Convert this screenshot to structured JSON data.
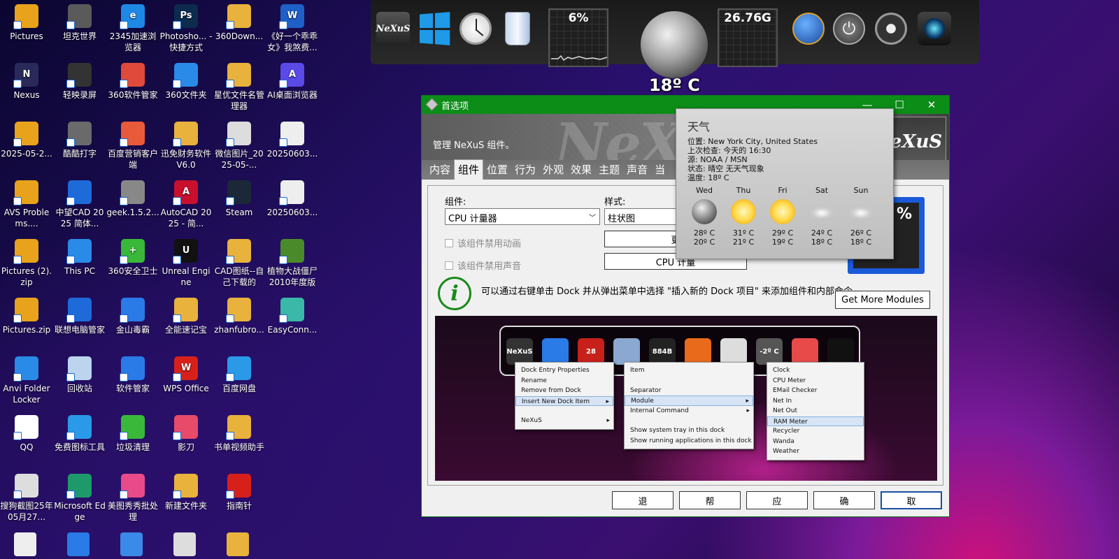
{
  "desktop": {
    "icons": [
      {
        "label": "Pictures",
        "color": "#e8a21c",
        "glyph": ""
      },
      {
        "label": "坦克世界",
        "color": "#5a5a5a",
        "glyph": ""
      },
      {
        "label": "2345加速浏览器",
        "color": "#1e88e5",
        "glyph": "e"
      },
      {
        "label": "Photosho... - 快捷方式",
        "color": "#0d2b4e",
        "glyph": "Ps"
      },
      {
        "label": "360Down...",
        "color": "#e8b23c",
        "glyph": ""
      },
      {
        "label": "《好一个乖乖女》我煞费...",
        "color": "#1e5fc8",
        "glyph": "W"
      },
      {
        "label": "Nexus",
        "color": "#2a2a5a",
        "glyph": "N"
      },
      {
        "label": "轻映录屏",
        "color": "#333333",
        "glyph": ""
      },
      {
        "label": "360软件管家",
        "color": "#e04a3a",
        "glyph": ""
      },
      {
        "label": "360文件夹",
        "color": "#2a8ae8",
        "glyph": ""
      },
      {
        "label": "星优文件名管理器",
        "color": "#e8b23c",
        "glyph": ""
      },
      {
        "label": "AI桌面浏览器",
        "color": "#5a4ae8",
        "glyph": "A"
      },
      {
        "label": "2025-05-2...",
        "color": "#e8a21c",
        "glyph": ""
      },
      {
        "label": "酷酷打字",
        "color": "#6a6a6a",
        "glyph": ""
      },
      {
        "label": "百度营销客户端",
        "color": "#e85a3a",
        "glyph": ""
      },
      {
        "label": "迅免财务软件V6.0",
        "color": "#e8b23c",
        "glyph": ""
      },
      {
        "label": "微信图片_2025-05-...",
        "color": "#dddddd",
        "glyph": ""
      },
      {
        "label": "20250603...",
        "color": "#eeeeee",
        "glyph": ""
      },
      {
        "label": "AVS Problems....",
        "color": "#e8a21c",
        "glyph": ""
      },
      {
        "label": "中望CAD 2025 简体...",
        "color": "#1e6ad8",
        "glyph": ""
      },
      {
        "label": "geek.1.5.2...",
        "color": "#888888",
        "glyph": ""
      },
      {
        "label": "AutoCAD 2025 - 简...",
        "color": "#c8102e",
        "glyph": "A"
      },
      {
        "label": "Steam",
        "color": "#1b2838",
        "glyph": ""
      },
      {
        "label": "20250603...",
        "color": "#eeeeee",
        "glyph": ""
      },
      {
        "label": "Pictures (2).zip",
        "color": "#e8a21c",
        "glyph": ""
      },
      {
        "label": "This PC",
        "color": "#2a8ae8",
        "glyph": ""
      },
      {
        "label": "360安全卫士",
        "color": "#3ab83a",
        "glyph": "+"
      },
      {
        "label": "Unreal Engine",
        "color": "#111111",
        "glyph": "U"
      },
      {
        "label": "CAD图纸--自己下载的",
        "color": "#e8b23c",
        "glyph": ""
      },
      {
        "label": "植物大战僵尸2010年度版",
        "color": "#4a8a2a",
        "glyph": ""
      },
      {
        "label": "Pictures.zip",
        "color": "#e8a21c",
        "glyph": ""
      },
      {
        "label": "联想电脑管家",
        "color": "#1e6ad8",
        "glyph": ""
      },
      {
        "label": "金山毒霸",
        "color": "#2a7ae8",
        "glyph": ""
      },
      {
        "label": "全能速记宝",
        "color": "#e8b23c",
        "glyph": ""
      },
      {
        "label": "zhanfubro...",
        "color": "#e8b23c",
        "glyph": ""
      },
      {
        "label": "EasyConn...",
        "color": "#3ab8a8",
        "glyph": ""
      },
      {
        "label": "Anvi Folder Locker",
        "color": "#2a8ae8",
        "glyph": ""
      },
      {
        "label": "回收站",
        "color": "#bcd4ee",
        "glyph": ""
      },
      {
        "label": "软件管家",
        "color": "#2a7ae8",
        "glyph": ""
      },
      {
        "label": "WPS Office",
        "color": "#d8201a",
        "glyph": "W"
      },
      {
        "label": "百度网盘",
        "color": "#2a9ae8",
        "glyph": ""
      },
      {
        "label": "",
        "color": "",
        "glyph": ""
      },
      {
        "label": "QQ",
        "color": "#ffffff",
        "glyph": ""
      },
      {
        "label": "免费图标工具",
        "color": "#2a9ae8",
        "glyph": ""
      },
      {
        "label": "垃圾清理",
        "color": "#3ab83a",
        "glyph": ""
      },
      {
        "label": "影刀",
        "color": "#e84a6a",
        "glyph": ""
      },
      {
        "label": "书单视频助手",
        "color": "#e8b23c",
        "glyph": ""
      },
      {
        "label": "",
        "color": "",
        "glyph": ""
      },
      {
        "label": "搜狗截图25年05月27...",
        "color": "#dddddd",
        "glyph": ""
      },
      {
        "label": "Microsoft Edge",
        "color": "#1e9a6a",
        "glyph": ""
      },
      {
        "label": "美图秀秀批处理",
        "color": "#e84a8a",
        "glyph": ""
      },
      {
        "label": "新建文件夹",
        "color": "#e8b23c",
        "glyph": ""
      },
      {
        "label": "指南针",
        "color": "#d8201a",
        "glyph": ""
      },
      {
        "label": "",
        "color": "",
        "glyph": ""
      }
    ]
  },
  "top_dock": {
    "cpu_meter": "6%",
    "ram_meter": "26.76G",
    "temperature": "18º C"
  },
  "window": {
    "title": "首选项",
    "banner_text": "管理 NeXuS 组件。",
    "banner_watermark": "NeXuS",
    "banner_logo": "eXuS",
    "tabs": [
      "内容",
      "组件",
      "位置",
      "行为",
      "外观",
      "效果",
      "主题",
      "声音",
      "当"
    ],
    "active_tab": "组件",
    "component_label": "组件:",
    "component_value": "CPU 计量器",
    "style_label": "样式:",
    "style_value": "柱状图",
    "chk_animation": "该组件禁用动画",
    "chk_sound": "该组件禁用声音",
    "btn_change": "更",
    "btn_cpu": "CPU 计量",
    "info_text": "可以通过右键单击 Dock 并从弹出菜单中选择 \"插入新的 Dock 项目\" 来添加组件和内部命令。",
    "get_more_modules": "Get More Modules",
    "meter_preview": "%",
    "bottom_buttons": [
      "退",
      "帮",
      "应",
      "确",
      "取"
    ]
  },
  "preview": {
    "dock_labels": [
      "NeXuS",
      "",
      "28",
      "",
      "884B",
      "",
      "",
      "-2º C",
      "",
      ""
    ],
    "menu1": [
      "Dock Entry Properties",
      "Rename",
      "Remove from Dock",
      "Insert New Dock Item",
      "",
      "NeXuS"
    ],
    "menu2": [
      "Item",
      "",
      "Separator",
      "Module",
      "Internal Command",
      "",
      "Show system tray in this dock",
      "Show running applications in this dock"
    ],
    "menu3": [
      "Clock",
      "CPU Meter",
      "EMail Checker",
      "Net In",
      "Net Out",
      "RAM Meter",
      "Recycler",
      "Wanda",
      "Weather"
    ]
  },
  "weather": {
    "title": "天气",
    "location": "位置: New York City, United States",
    "last_check": "上次检查: 今天的 16:30",
    "source": "源: NOAA / MSN",
    "status": "状态: 晴空 无天气现象",
    "temperature": "温度: 18º C",
    "days": [
      {
        "name": "Wed",
        "icon": "moon",
        "high": "28º C",
        "low": "20º C"
      },
      {
        "name": "Thu",
        "icon": "sun",
        "high": "31º C",
        "low": "21º C"
      },
      {
        "name": "Fri",
        "icon": "sun",
        "high": "29º C",
        "low": "19º C"
      },
      {
        "name": "Sat",
        "icon": "cloud",
        "high": "24º C",
        "low": "18º C"
      },
      {
        "name": "Sun",
        "icon": "cloud",
        "high": "26º C",
        "low": "18º C"
      }
    ]
  }
}
